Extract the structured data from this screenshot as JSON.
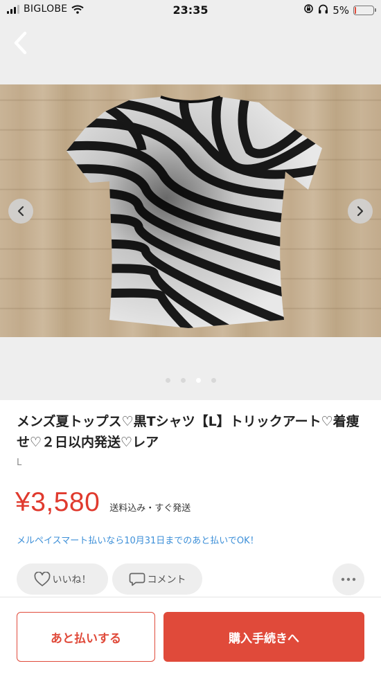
{
  "status_bar": {
    "carrier": "BIGLOBE",
    "time": "23:35",
    "battery": "5%",
    "battery_level": 0.05
  },
  "carousel": {
    "total_images": 4,
    "current_index": 3
  },
  "product": {
    "title": "メンズ夏トップス♡黒Tシャツ【L】トリックアート♡着痩せ♡２日以内発送♡レア",
    "size": "L",
    "price": "¥3,580",
    "shipping_note": "送料込み・すぐ発送",
    "merpay_note": "メルペイスマート払いなら10月31日までのあと払いでOK！"
  },
  "actions": {
    "like_label": "いいね！",
    "comment_label": "コメント"
  },
  "buttons": {
    "later_pay_label": "あと払いする",
    "purchase_label": "購入手続きへ"
  },
  "colors": {
    "accent": "#e04a3a",
    "link": "#3c8fd8",
    "price": "#e03a2e"
  },
  "icons": [
    "back-chevron-icon",
    "heart-icon",
    "comment-icon",
    "more-dots-icon",
    "chevron-left-icon",
    "chevron-right-icon",
    "wifi-icon",
    "headphones-icon",
    "rotation-lock-icon"
  ]
}
